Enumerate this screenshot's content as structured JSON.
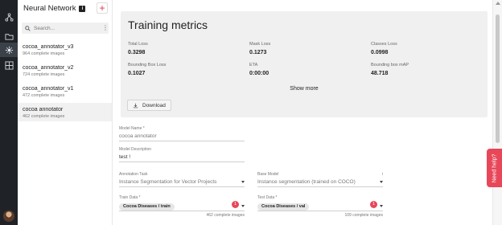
{
  "rail": {
    "icons": [
      "network-icon",
      "folder-icon",
      "neural-network-icon",
      "grid-icon"
    ],
    "active_index": 2
  },
  "sidebar": {
    "title": "Neural Network",
    "badge": "i",
    "add_label": "+",
    "search_placeholder": "Search...",
    "items": [
      {
        "name": "cocoa_annotator_v3",
        "sub": "964 complete images"
      },
      {
        "name": "cocoa_annotator_v2",
        "sub": "724 complete images"
      },
      {
        "name": "cocoa_annotator_v1",
        "sub": "472 complete images"
      },
      {
        "name": "cocoa annotator",
        "sub": "462 complete images"
      }
    ],
    "selected_index": 3
  },
  "metrics": {
    "title": "Training metrics",
    "total_loss": {
      "label": "Total Loss",
      "value": "0.3298"
    },
    "mask_loss": {
      "label": "Mask Loss",
      "value": "0.1273"
    },
    "classes_loss": {
      "label": "Classes Loss",
      "value": "0.0998"
    },
    "bbox_loss": {
      "label": "Bounding Box Loss",
      "value": "0.1027"
    },
    "eta": {
      "label": "ETA",
      "value": "0:00:00"
    },
    "bbox_map": {
      "label": "Bounding box mAP",
      "value": "48.718"
    },
    "show_more": "Show more",
    "download": "Download"
  },
  "form": {
    "model_name": {
      "label": "Model Name *",
      "value": "cocoa annotator"
    },
    "model_description": {
      "label": "Model Description",
      "value": "test !"
    },
    "annotation_task": {
      "label": "Annotation Task",
      "value": "Instance Segmentation for Vector Projects"
    },
    "base_model": {
      "label": "Base Model",
      "value": "Instance segmentation (trained on COCO)",
      "info": "i"
    },
    "train_data": {
      "label": "Train Data *",
      "chip": "Cocoa Diseases / train",
      "count": "1",
      "note": "462 complete images"
    },
    "test_data": {
      "label": "Test Data *",
      "chip": "Cocoa Diseases / val",
      "count": "1",
      "note": "109 complete images"
    }
  },
  "help": {
    "label": "Need help?"
  },
  "colors": {
    "accent": "#e8475a",
    "rail": "#1f2328",
    "panel": "#f0f0f0"
  }
}
